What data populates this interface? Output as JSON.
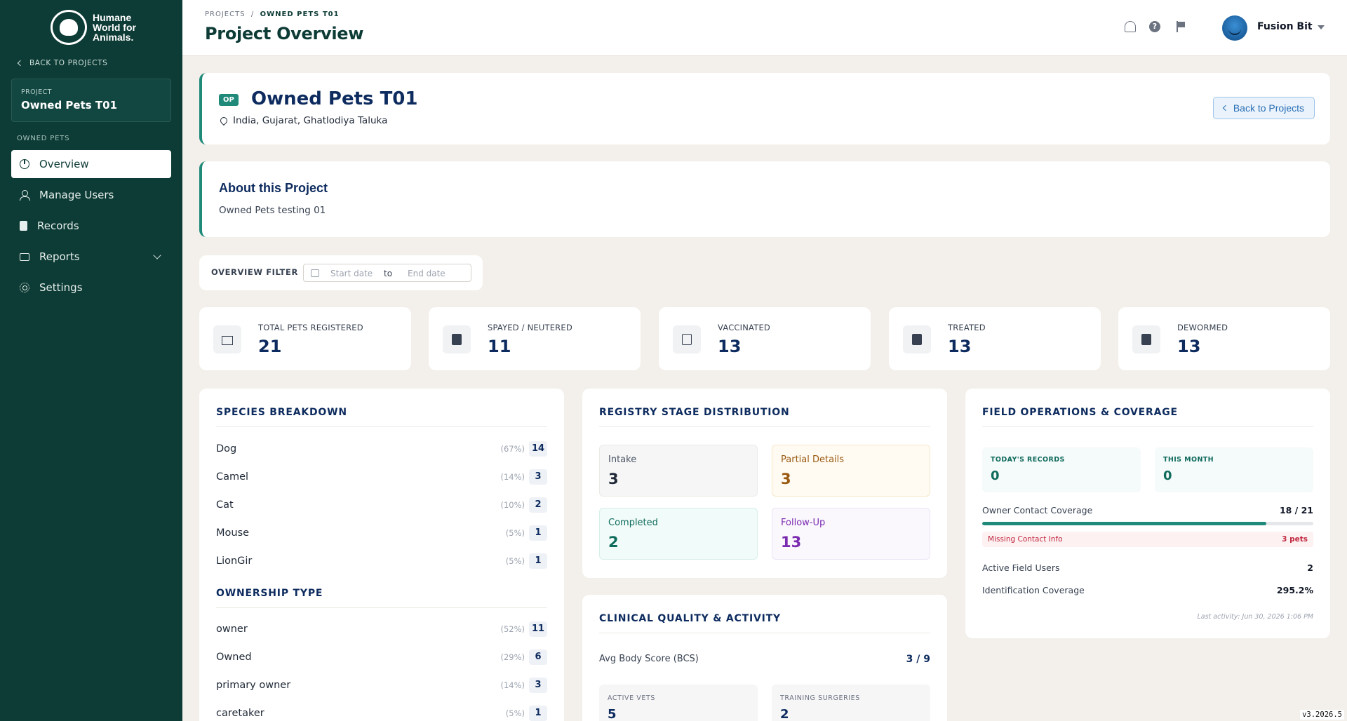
{
  "brand": {
    "logo_text": "Humane World for Animals."
  },
  "sidebar": {
    "back_label": "BACK TO PROJECTS",
    "project_label": "PROJECT",
    "project_name": "Owned Pets T01",
    "section_label": "OWNED PETS",
    "items": [
      {
        "label": "Overview",
        "icon": "pie-chart-icon",
        "active": true
      },
      {
        "label": "Manage Users",
        "icon": "user-icon"
      },
      {
        "label": "Records",
        "icon": "clipboard-icon"
      },
      {
        "label": "Reports",
        "icon": "report-icon"
      },
      {
        "label": "Settings",
        "icon": "gear-icon"
      }
    ]
  },
  "header": {
    "breadcrumb_root": "PROJECTS",
    "breadcrumb_sep": "/",
    "breadcrumb_current": "OWNED PETS T01",
    "title": "Project Overview",
    "help_glyph": "?",
    "user_name": "Fusion Bit"
  },
  "project": {
    "badge": "OP",
    "name": "Owned Pets T01",
    "location": "India, Gujarat, Ghatlodiya Taluka",
    "back_button": "Back to Projects"
  },
  "about": {
    "title": "About this Project",
    "text": "Owned Pets testing 01"
  },
  "filter": {
    "label": "OVERVIEW FILTER",
    "start_placeholder": "Start date",
    "to": "to",
    "end_placeholder": "End date"
  },
  "stats": [
    {
      "label": "TOTAL PETS REGISTERED",
      "value": "21"
    },
    {
      "label": "SPAYED / NEUTERED",
      "value": "11"
    },
    {
      "label": "VACCINATED",
      "value": "13"
    },
    {
      "label": "TREATED",
      "value": "13"
    },
    {
      "label": "DEWORMED",
      "value": "13"
    }
  ],
  "species": {
    "title": "SPECIES BREAKDOWN",
    "rows": [
      {
        "name": "Dog",
        "pct": "(67%)",
        "count": "14"
      },
      {
        "name": "Camel",
        "pct": "(14%)",
        "count": "3"
      },
      {
        "name": "Cat",
        "pct": "(10%)",
        "count": "2"
      },
      {
        "name": "Mouse",
        "pct": "(5%)",
        "count": "1"
      },
      {
        "name": "LionGir",
        "pct": "(5%)",
        "count": "1"
      }
    ]
  },
  "ownership": {
    "title": "OWNERSHIP TYPE",
    "rows": [
      {
        "name": "owner",
        "pct": "(52%)",
        "count": "11"
      },
      {
        "name": "Owned",
        "pct": "(29%)",
        "count": "6"
      },
      {
        "name": "primary owner",
        "pct": "(14%)",
        "count": "3"
      },
      {
        "name": "caretaker",
        "pct": "(5%)",
        "count": "1"
      }
    ]
  },
  "registry": {
    "title": "REGISTRY STAGE DISTRIBUTION",
    "intake_label": "Intake",
    "intake_value": "3",
    "partial_label": "Partial Details",
    "partial_value": "3",
    "completed_label": "Completed",
    "completed_value": "2",
    "followup_label": "Follow-Up",
    "followup_value": "13"
  },
  "clinical": {
    "title": "CLINICAL QUALITY & ACTIVITY",
    "bcs_label": "Avg Body Score (BCS)",
    "bcs_value": "3 / 9",
    "vets_label": "ACTIVE VETS",
    "vets_value": "5",
    "training_label": "TRAINING SURGERIES",
    "training_value": "2"
  },
  "field_ops": {
    "title": "FIELD OPERATIONS & COVERAGE",
    "today_label": "TODAY'S RECORDS",
    "today_value": "0",
    "month_label": "THIS MONTH",
    "month_value": "0",
    "contact_label": "Owner Contact Coverage",
    "contact_value": "18 / 21",
    "contact_fraction": 0.857,
    "missing_label": "Missing Contact Info",
    "missing_value": "3 pets",
    "active_users_label": "Active Field Users",
    "active_users_value": "2",
    "id_coverage_label": "Identification Coverage",
    "id_coverage_value": "295.2%",
    "last_activity": "Last activity: Jun 30, 2026 1:06 PM"
  },
  "version": "v3.2026.5"
}
